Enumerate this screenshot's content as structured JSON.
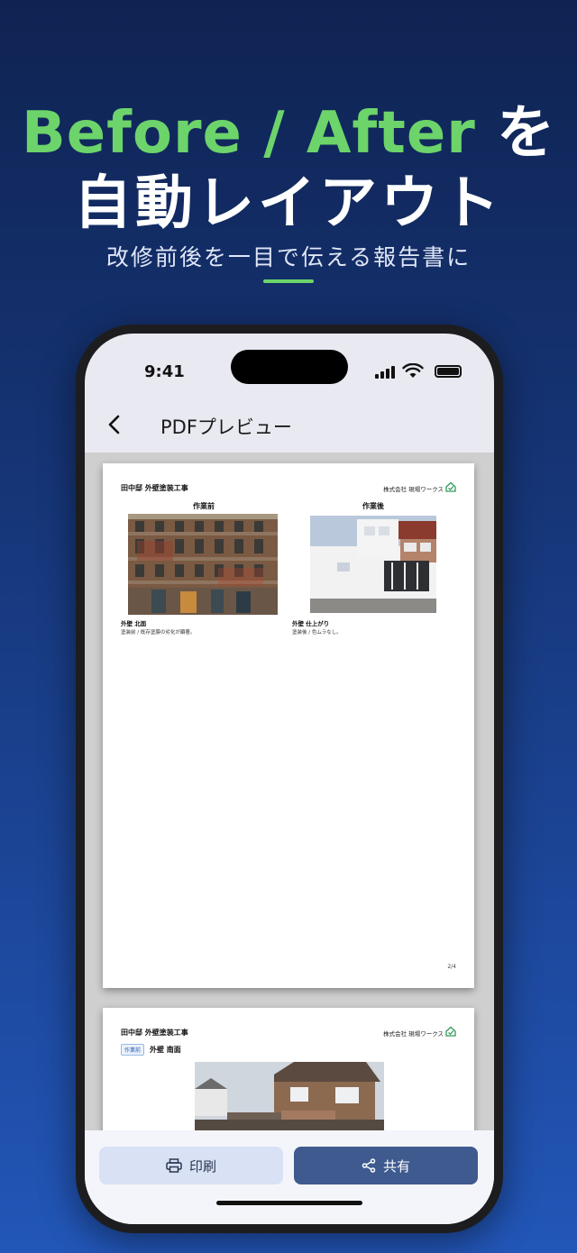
{
  "promo": {
    "headline_part1": "Before / After",
    "headline_part2": "を",
    "headline_line2": "自動レイアウト",
    "subline": "改修前後を一目で伝える報告書に"
  },
  "status_bar": {
    "time": "9:41"
  },
  "nav": {
    "title": "PDFプレビュー",
    "back_icon": "chevron-left-icon"
  },
  "pdf": {
    "page1": {
      "project_title": "田中邸 外壁塗装工事",
      "company": "株式会社 現場ワークス",
      "before_heading": "作業前",
      "after_heading": "作業後",
      "before_caption_title": "外壁 北面",
      "before_caption_text": "塗装前 / 既存塗膜の劣化が顕著。",
      "after_caption_title": "外壁 仕上がり",
      "after_caption_text": "塗装後 / 色ムラなし。",
      "page_number": "2/4"
    },
    "page2": {
      "project_title": "田中邸 外壁塗装工事",
      "company": "株式会社 現場ワークス",
      "tag": "作業前",
      "area_label": "外壁 南面"
    }
  },
  "actions": {
    "print_label": "印刷",
    "share_label": "共有"
  },
  "colors": {
    "accent_green": "#6cd46a",
    "share_button": "#3e5a8f",
    "print_button": "#d9e1f5"
  }
}
